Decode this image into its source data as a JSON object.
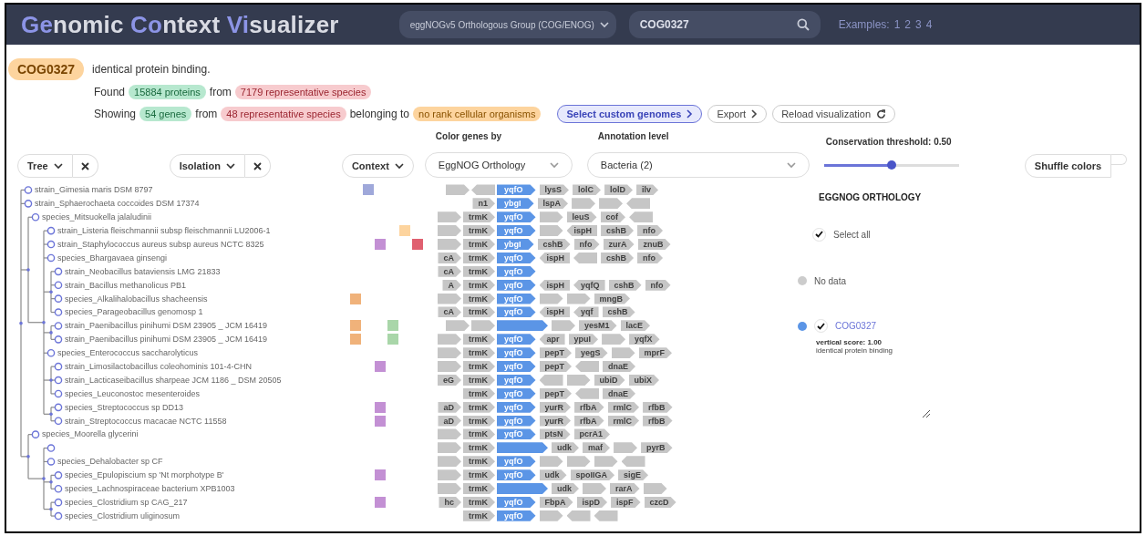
{
  "header": {
    "title": [
      {
        "text": "Ge",
        "accent": true
      },
      {
        "text": "nomic ",
        "accent": false
      },
      {
        "text": "Co",
        "accent": true
      },
      {
        "text": "ntext ",
        "accent": false
      },
      {
        "text": "Vi",
        "accent": true
      },
      {
        "text": "sualizer",
        "accent": false
      }
    ],
    "source_select": "eggNOGv5 Orthologous Group (COG/ENOG)",
    "search": {
      "value": "COG0327"
    },
    "examples_label": "Examples:",
    "examples": [
      "1",
      "2",
      "3",
      "4"
    ]
  },
  "summary": {
    "query": "COG0327",
    "description": "identical protein binding.",
    "lines": [
      [
        {
          "kind": "text",
          "text": "Found"
        },
        {
          "kind": "green",
          "text": "15884 proteins"
        },
        {
          "kind": "text",
          "text": "from"
        },
        {
          "kind": "red",
          "text": "7179 representative species"
        }
      ],
      [
        {
          "kind": "text",
          "text": "Showing"
        },
        {
          "kind": "green",
          "text": "54 genes"
        },
        {
          "kind": "text",
          "text": "from"
        },
        {
          "kind": "red",
          "text": "48 representative species"
        },
        {
          "kind": "text",
          "text": "belonging to"
        },
        {
          "kind": "orange",
          "text": "no rank cellular organisms"
        },
        {
          "kind": "primary",
          "text": "Select custom genomes"
        },
        {
          "kind": "button",
          "text": "Export"
        },
        {
          "kind": "reload",
          "text": "Reload visualization"
        }
      ]
    ]
  },
  "controls": {
    "tree": {
      "label": "Tree"
    },
    "isolation": {
      "label": "Isolation"
    },
    "context": {
      "label": "Context"
    },
    "color_by": {
      "label": "Color genes by",
      "value": "EggNOG Orthology"
    },
    "annotation": {
      "label": "Annotation level",
      "value": "Bacteria (2)"
    },
    "threshold": {
      "label": "Conservation threshold: 0.50",
      "level": 0.5
    },
    "shuffle": {
      "label": "Shuffle colors"
    }
  },
  "tree": [
    {
      "kind": "clade",
      "children": [
        {
          "kind": "node",
          "label": "strain_Gimesia maris DSM 8797"
        },
        {
          "kind": "node",
          "label": "strain_Sphaerochaeta coccoides DSM 17374"
        },
        {
          "kind": "clade",
          "children": [
            {
              "kind": "node",
              "label": "species_Mitsuokella jalaludinii"
            },
            {
              "kind": "clade",
              "children": [
                {
                  "kind": "node",
                  "label": "strain_Listeria fleischmannii subsp fleischmannii LU2006-1"
                },
                {
                  "kind": "node",
                  "label": "strain_Staphylococcus aureus subsp aureus NCTC 8325"
                },
                {
                  "kind": "node",
                  "label": "species_Bhargavaea ginsengi"
                },
                {
                  "kind": "clade",
                  "children": [
                    {
                      "kind": "node",
                      "label": "strain_Neobacillus bataviensis LMG 21833"
                    },
                    {
                      "kind": "node",
                      "label": "strain_Bacillus methanolicus PB1"
                    },
                    {
                      "kind": "node",
                      "label": "species_Alkalihalobacillus shacheensis"
                    },
                    {
                      "kind": "node",
                      "label": "species_Parageobacillus genomosp 1"
                    }
                  ]
                },
                {
                  "kind": "clade",
                  "children": [
                    {
                      "kind": "node",
                      "label": "strain_Paenibacillus pinihumi DSM 23905 _ JCM 16419"
                    },
                    {
                      "kind": "node",
                      "label": "strain_Paenibacillus pinihumi DSM 23905 _ JCM 16419"
                    }
                  ]
                },
                {
                  "kind": "node",
                  "label": "species_Enterococcus saccharolyticus"
                },
                {
                  "kind": "clade",
                  "children": [
                    {
                      "kind": "node",
                      "label": "strain_Limosilactobacillus coleohominis 101-4-CHN"
                    },
                    {
                      "kind": "node",
                      "label": "strain_Lacticaseibacillus sharpeae JCM 1186 _ DSM 20505"
                    },
                    {
                      "kind": "node",
                      "label": "species_Leuconostoc mesenteroides"
                    }
                  ]
                },
                {
                  "kind": "clade",
                  "children": [
                    {
                      "kind": "node",
                      "label": "species_Streptococcus sp DD13"
                    },
                    {
                      "kind": "node",
                      "label": "strain_Streptococcus macacae NCTC 11558"
                    }
                  ]
                }
              ]
            }
          ]
        },
        {
          "kind": "clade",
          "children": [
            {
              "kind": "node",
              "label": "species_Moorella glycerini"
            },
            {
              "kind": "clade",
              "children": [
                {
                  "kind": "node"
                },
                {
                  "kind": "node",
                  "label": "species_Dehalobacter sp CF"
                },
                {
                  "kind": "clade",
                  "children": [
                    {
                      "kind": "node",
                      "label": "species_Epulopiscium sp 'Nt morphotype B'"
                    },
                    {
                      "kind": "node",
                      "label": "species_Lachnospiraceae bacterium XPB1003"
                    }
                  ]
                },
                {
                  "kind": "clade",
                  "children": [
                    {
                      "kind": "node",
                      "label": "species_Clostridium sp CAG_217"
                    },
                    {
                      "kind": "node",
                      "label": "species_Clostridium uliginosum"
                    }
                  ]
                }
              ]
            }
          ]
        }
      ]
    }
  ],
  "rows": [
    {
      "context": {
        "column_2": {
          "color": "#9fa8da"
        }
      },
      "left": [
        {
          "reverse": false
        },
        {
          "reverse": true
        }
      ],
      "focus": {
        "name": "yqfO",
        "reverse": false
      },
      "right": [
        {
          "name": "lysS",
          "reverse": false
        },
        {
          "name": "lolC",
          "reverse": false
        },
        {
          "name": "lolD",
          "reverse": false
        },
        {
          "name": "ilv",
          "reverse": false
        }
      ]
    },
    {
      "context": {},
      "left": [
        {
          "name": "n1",
          "reverse": false
        }
      ],
      "focus": {
        "name": "ybgI",
        "reverse": false
      },
      "right": [
        {
          "name": "lspA",
          "reverse": false
        },
        {
          "reverse": false
        },
        {
          "reverse": false
        },
        {
          "reverse": true
        }
      ]
    },
    {
      "context": {},
      "left": [
        {
          "reverse": false
        },
        {
          "name": "trmK",
          "reverse": false
        }
      ],
      "focus": {
        "name": "yqfO",
        "reverse": false
      },
      "right": [
        {
          "reverse": false
        },
        {
          "name": "leuS",
          "reverse": false
        },
        {
          "name": "cof",
          "reverse": false
        },
        {
          "reverse": true
        }
      ]
    },
    {
      "context": {
        "column_5": {
          "color": "#fdd49e"
        }
      },
      "left": [
        {
          "reverse": false
        },
        {
          "name": "trmK",
          "reverse": false
        }
      ],
      "focus": {
        "name": "yqfO",
        "reverse": false
      },
      "right": [
        {
          "reverse": false
        },
        {
          "name": "ispH",
          "reverse": true
        },
        {
          "name": "cshB",
          "reverse": false
        },
        {
          "name": "nfo",
          "reverse": false
        }
      ]
    },
    {
      "context": {
        "column_3": {
          "color": "#c390d4"
        },
        "column_6": {
          "color": "#e06070"
        }
      },
      "left": [
        {
          "reverse": false
        },
        {
          "name": "trmK",
          "reverse": false
        }
      ],
      "focus": {
        "name": "ybgI",
        "reverse": false
      },
      "right": [
        {
          "name": "cshB",
          "reverse": false
        },
        {
          "name": "nfo",
          "reverse": false
        },
        {
          "name": "zurA",
          "reverse": false
        },
        {
          "name": "znuB",
          "reverse": false
        }
      ]
    },
    {
      "context": {},
      "left": [
        {
          "name": "cA",
          "reverse": false
        },
        {
          "name": "trmK",
          "reverse": false
        }
      ],
      "focus": {
        "name": "yqfO",
        "reverse": false
      },
      "right": [
        {
          "name": "ispH",
          "reverse": true
        },
        {
          "reverse": true
        },
        {
          "name": "cshB",
          "reverse": false
        },
        {
          "name": "nfo",
          "reverse": false
        }
      ]
    },
    {
      "context": {},
      "left": [
        {
          "name": "cA",
          "reverse": false
        },
        {
          "name": "trmK",
          "reverse": false
        }
      ],
      "focus": {
        "name": "yqfO",
        "reverse": false
      }
    },
    {
      "context": {},
      "left": [
        {
          "name": "A",
          "reverse": false
        },
        {
          "name": "trmK",
          "reverse": false
        }
      ],
      "focus": {
        "name": "yqfO",
        "reverse": false
      },
      "right": [
        {
          "name": "ispH",
          "reverse": true
        },
        {
          "name": "yqfQ",
          "reverse": true
        },
        {
          "name": "cshB",
          "reverse": false
        },
        {
          "name": "nfo",
          "reverse": false
        }
      ]
    },
    {
      "context": {
        "column_1": {
          "color": "#f0b27a"
        }
      },
      "left": [
        {
          "reverse": false
        },
        {
          "name": "trmK",
          "reverse": false
        }
      ],
      "focus": {
        "name": "yqfO",
        "reverse": false
      },
      "right": [
        {
          "reverse": false
        },
        {
          "reverse": false
        },
        {
          "name": "mngB",
          "reverse": false
        }
      ]
    },
    {
      "context": {},
      "left": [
        {
          "name": "cA",
          "reverse": false
        },
        {
          "name": "trmK",
          "reverse": false
        }
      ],
      "focus": {
        "name": "yqfO",
        "reverse": false
      },
      "right": [
        {
          "name": "ispH",
          "reverse": true
        },
        {
          "name": "yqf",
          "reverse": true
        },
        {
          "name": "cshB",
          "reverse": false
        }
      ]
    },
    {
      "context": {
        "column_1": {
          "color": "#f0b27a"
        },
        "column_4": {
          "color": "#a9d6a9"
        }
      },
      "left": [
        {
          "reverse": false
        },
        {
          "reverse": false
        }
      ],
      "focus": {
        "reverse": false
      },
      "right": [
        {
          "reverse": false
        },
        {
          "name": "yesM1",
          "reverse": false
        },
        {
          "name": "lacE",
          "reverse": false
        }
      ]
    },
    {
      "context": {
        "column_1": {
          "color": "#f0b27a"
        },
        "column_4": {
          "color": "#a9d6a9"
        }
      },
      "left": [
        {
          "reverse": false
        },
        {
          "name": "trmK",
          "reverse": false
        }
      ],
      "focus": {
        "name": "yqfO",
        "reverse": false
      },
      "right": [
        {
          "name": "apr",
          "reverse": true
        },
        {
          "name": "ypuI",
          "reverse": false
        },
        {
          "reverse": false
        },
        {
          "name": "yqfX",
          "reverse": false
        }
      ]
    },
    {
      "context": {},
      "left": [
        {
          "reverse": false
        },
        {
          "name": "trmK",
          "reverse": false
        }
      ],
      "focus": {
        "name": "yqfO",
        "reverse": false
      },
      "right": [
        {
          "name": "pepT",
          "reverse": false
        },
        {
          "name": "yegS",
          "reverse": false
        },
        {
          "reverse": false
        },
        {
          "name": "mprF",
          "reverse": false
        }
      ]
    },
    {
      "context": {
        "column_3": {
          "color": "#c390d4"
        }
      },
      "left": [
        {
          "reverse": false
        },
        {
          "name": "trmK",
          "reverse": false
        }
      ],
      "focus": {
        "name": "yqfO",
        "reverse": false
      },
      "right": [
        {
          "name": "pepT",
          "reverse": false
        },
        {
          "reverse": true
        },
        {
          "name": "dnaE",
          "reverse": false
        }
      ]
    },
    {
      "context": {},
      "left": [
        {
          "name": "eG",
          "reverse": false
        },
        {
          "name": "trmK",
          "reverse": false
        }
      ],
      "focus": {
        "name": "yqfO",
        "reverse": false
      },
      "right": [
        {
          "reverse": true
        },
        {
          "reverse": false
        },
        {
          "name": "ubiD",
          "reverse": false
        },
        {
          "name": "ubiX",
          "reverse": false
        }
      ]
    },
    {
      "context": {},
      "left": [
        {
          "name": "trmK",
          "reverse": false
        }
      ],
      "focus": {
        "name": "yqfO",
        "reverse": false
      },
      "right": [
        {
          "name": "pepT",
          "reverse": false
        },
        {
          "reverse": true
        },
        {
          "name": "dnaE",
          "reverse": false
        }
      ]
    },
    {
      "context": {
        "column_3": {
          "color": "#c390d4"
        }
      },
      "left": [
        {
          "name": "aD",
          "reverse": false
        },
        {
          "name": "trmK",
          "reverse": false
        }
      ],
      "focus": {
        "name": "yqfO",
        "reverse": false
      },
      "right": [
        {
          "name": "yurR",
          "reverse": false
        },
        {
          "name": "rfbA",
          "reverse": false
        },
        {
          "name": "rmlC",
          "reverse": false
        },
        {
          "name": "rfbB",
          "reverse": false
        }
      ]
    },
    {
      "context": {
        "column_3": {
          "color": "#c390d4"
        }
      },
      "left": [
        {
          "name": "aD",
          "reverse": false
        },
        {
          "name": "trmK",
          "reverse": false
        }
      ],
      "focus": {
        "name": "yqfO",
        "reverse": false
      },
      "right": [
        {
          "name": "yurR",
          "reverse": false
        },
        {
          "name": "rfbA",
          "reverse": false
        },
        {
          "name": "rmlC",
          "reverse": false
        },
        {
          "name": "rfbB",
          "reverse": false
        }
      ]
    },
    {
      "context": {},
      "left": [
        {
          "reverse": false
        },
        {
          "name": "trmK",
          "reverse": false
        }
      ],
      "focus": {
        "name": "yqfO",
        "reverse": false
      },
      "right": [
        {
          "name": "ptsN",
          "reverse": false
        },
        {
          "name": "pcrA1",
          "reverse": false
        }
      ]
    },
    {
      "context": {},
      "left": [
        {
          "reverse": false
        },
        {
          "name": "trmK",
          "reverse": false
        }
      ],
      "focus": {
        "reverse": false
      },
      "right": [
        {
          "name": "udk",
          "reverse": false
        },
        {
          "name": "maf",
          "reverse": false
        },
        {
          "reverse": false
        },
        {
          "name": "pyrB",
          "reverse": false
        }
      ]
    },
    {
      "context": {},
      "left": [
        {
          "reverse": false
        },
        {
          "name": "trmK",
          "reverse": false
        }
      ],
      "focus": {
        "name": "yqfO",
        "reverse": false
      },
      "right": [
        {
          "reverse": false
        },
        {
          "reverse": false
        },
        {
          "reverse": false
        },
        {
          "reverse": true
        }
      ]
    },
    {
      "context": {
        "column_3": {
          "color": "#c390d4"
        }
      },
      "left": [
        {
          "reverse": false
        },
        {
          "name": "trmK",
          "reverse": false
        }
      ],
      "focus": {
        "name": "yqfO",
        "reverse": false
      },
      "right": [
        {
          "name": "udk",
          "reverse": false
        },
        {
          "name": "spoIIGA",
          "reverse": false
        },
        {
          "name": "sigE",
          "reverse": false
        }
      ]
    },
    {
      "context": {},
      "left": [
        {
          "reverse": false
        },
        {
          "name": "trmK",
          "reverse": false
        }
      ],
      "focus": {
        "reverse": false
      },
      "right": [
        {
          "name": "udk",
          "reverse": false
        },
        {
          "reverse": false
        },
        {
          "name": "rarA",
          "reverse": false
        },
        {
          "reverse": false
        }
      ]
    },
    {
      "context": {
        "column_3": {
          "color": "#c390d4"
        }
      },
      "left": [
        {
          "name": "hc",
          "reverse": false
        },
        {
          "name": "trmK",
          "reverse": false
        }
      ],
      "focus": {
        "name": "yqfO",
        "reverse": false
      },
      "right": [
        {
          "name": "FbpA",
          "reverse": false
        },
        {
          "name": "ispD",
          "reverse": false
        },
        {
          "name": "ispF",
          "reverse": false
        },
        {
          "name": "czcD",
          "reverse": false
        }
      ]
    },
    {
      "context": {},
      "left": [
        {
          "name": "trmK",
          "reverse": false
        }
      ],
      "focus": {
        "name": "yqfO",
        "reverse": false
      },
      "right": [
        {
          "reverse": false
        },
        {
          "reverse": true
        },
        {
          "reverse": true
        }
      ]
    }
  ],
  "legend": {
    "title": "EGGNOG ORTHOLOGY",
    "items": [
      {
        "kind": "toggle",
        "label": "Select all",
        "checked": true
      },
      {
        "kind": "swatch",
        "label": "No data",
        "color": "#cccccc"
      },
      {
        "kind": "group",
        "label": "COG0327",
        "color": "#5b95e6",
        "checked": true,
        "score": "vertical score: 1.00",
        "description": "identical protein binding"
      }
    ]
  }
}
